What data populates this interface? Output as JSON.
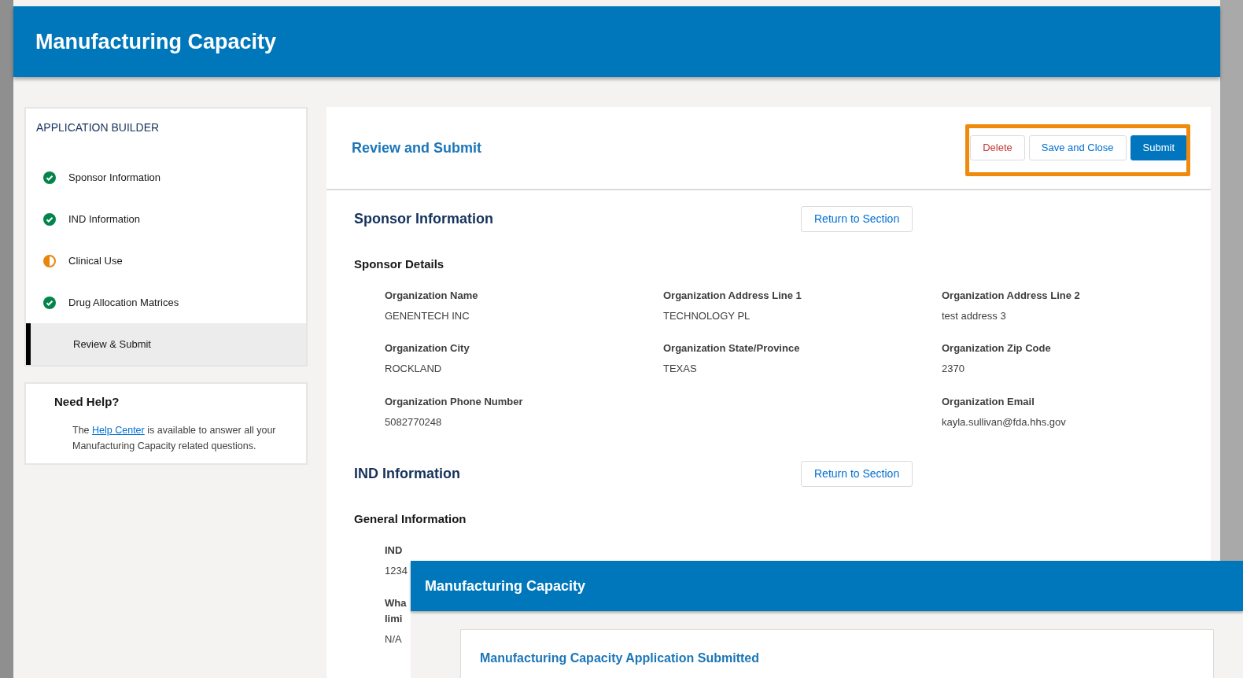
{
  "header": {
    "title": "Manufacturing Capacity"
  },
  "sidebar": {
    "title": "APPLICATION BUILDER",
    "items": [
      {
        "label": "Sponsor Information",
        "kind": "complete",
        "selected": false
      },
      {
        "label": "IND Information",
        "kind": "complete",
        "selected": false
      },
      {
        "label": "Clinical Use",
        "kind": "partial",
        "selected": false
      },
      {
        "label": "Drug Allocation Matrices",
        "kind": "complete",
        "selected": false
      },
      {
        "label": "Review & Submit",
        "kind": "none",
        "selected": true
      }
    ]
  },
  "help": {
    "title": "Need Help?",
    "before": "The",
    "link": "Help Center",
    "after": "is available to answer all your Manufacturing Capacity related questions."
  },
  "main": {
    "title": "Review and Submit",
    "buttons": [
      {
        "label": "Delete",
        "kind": "danger"
      },
      {
        "label": "Save and Close",
        "kind": "neutral"
      },
      {
        "label": "Submit",
        "kind": "brand"
      }
    ],
    "sections": [
      {
        "title": "Sponsor Information",
        "action": "Return to Section",
        "groups": [
          {
            "title": "Sponsor Details",
            "rows": [
              {
                "left": {
                  "label": [
                    "Organization Name"
                  ],
                  "value": "GENENTECH INC"
                },
                "middle": {
                  "label": [
                    "Organization Address Line 1"
                  ],
                  "value": "TECHNOLOGY PL"
                },
                "right": {
                  "label": [
                    "Organization Address Line 2"
                  ],
                  "value": "test address 3"
                }
              },
              {
                "left": {
                  "label": [
                    "Organization City"
                  ],
                  "value": "ROCKLAND"
                },
                "middle": {
                  "label": [
                    "Organization State/Province"
                  ],
                  "value": "TEXAS"
                },
                "right": {
                  "label": [
                    "Organization Zip Code"
                  ],
                  "value": "2370"
                }
              },
              {
                "left": {
                  "label": [
                    "Organization Phone Number"
                  ],
                  "value": "5082770248"
                },
                "right": {
                  "label": [
                    "Organization Email"
                  ],
                  "value": "kayla.sullivan@fda.hhs.gov"
                }
              }
            ]
          }
        ]
      },
      {
        "title": "IND Information",
        "action": "Return to Section",
        "groups": [
          {
            "title": "General Information",
            "rows": [
              {
                "left": {
                  "label": [
                    "IND"
                  ],
                  "value": "1234"
                }
              },
              {
                "left": {
                  "label": [
                    "Wha",
                    "limi"
                  ],
                  "value": "N/A"
                }
              }
            ]
          }
        ]
      }
    ]
  },
  "overlay": {
    "title": "Manufacturing Capacity",
    "message": "Manufacturing Capacity Application Submitted"
  }
}
